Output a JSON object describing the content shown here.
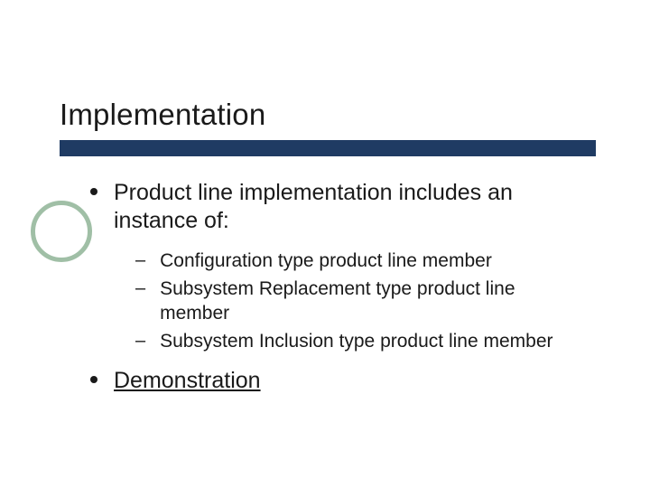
{
  "slide": {
    "title": "Implementation",
    "bullets": [
      {
        "text": "Product line implementation includes an instance of:",
        "sub": [
          "Configuration type product line member",
          "Subsystem Replacement type product line member",
          "Subsystem Inclusion type product line member"
        ]
      },
      {
        "text": "Demonstration",
        "link": true
      }
    ]
  },
  "theme": {
    "accent_bar": "#1f3b63",
    "circle_stroke": "#a0bfa6"
  }
}
